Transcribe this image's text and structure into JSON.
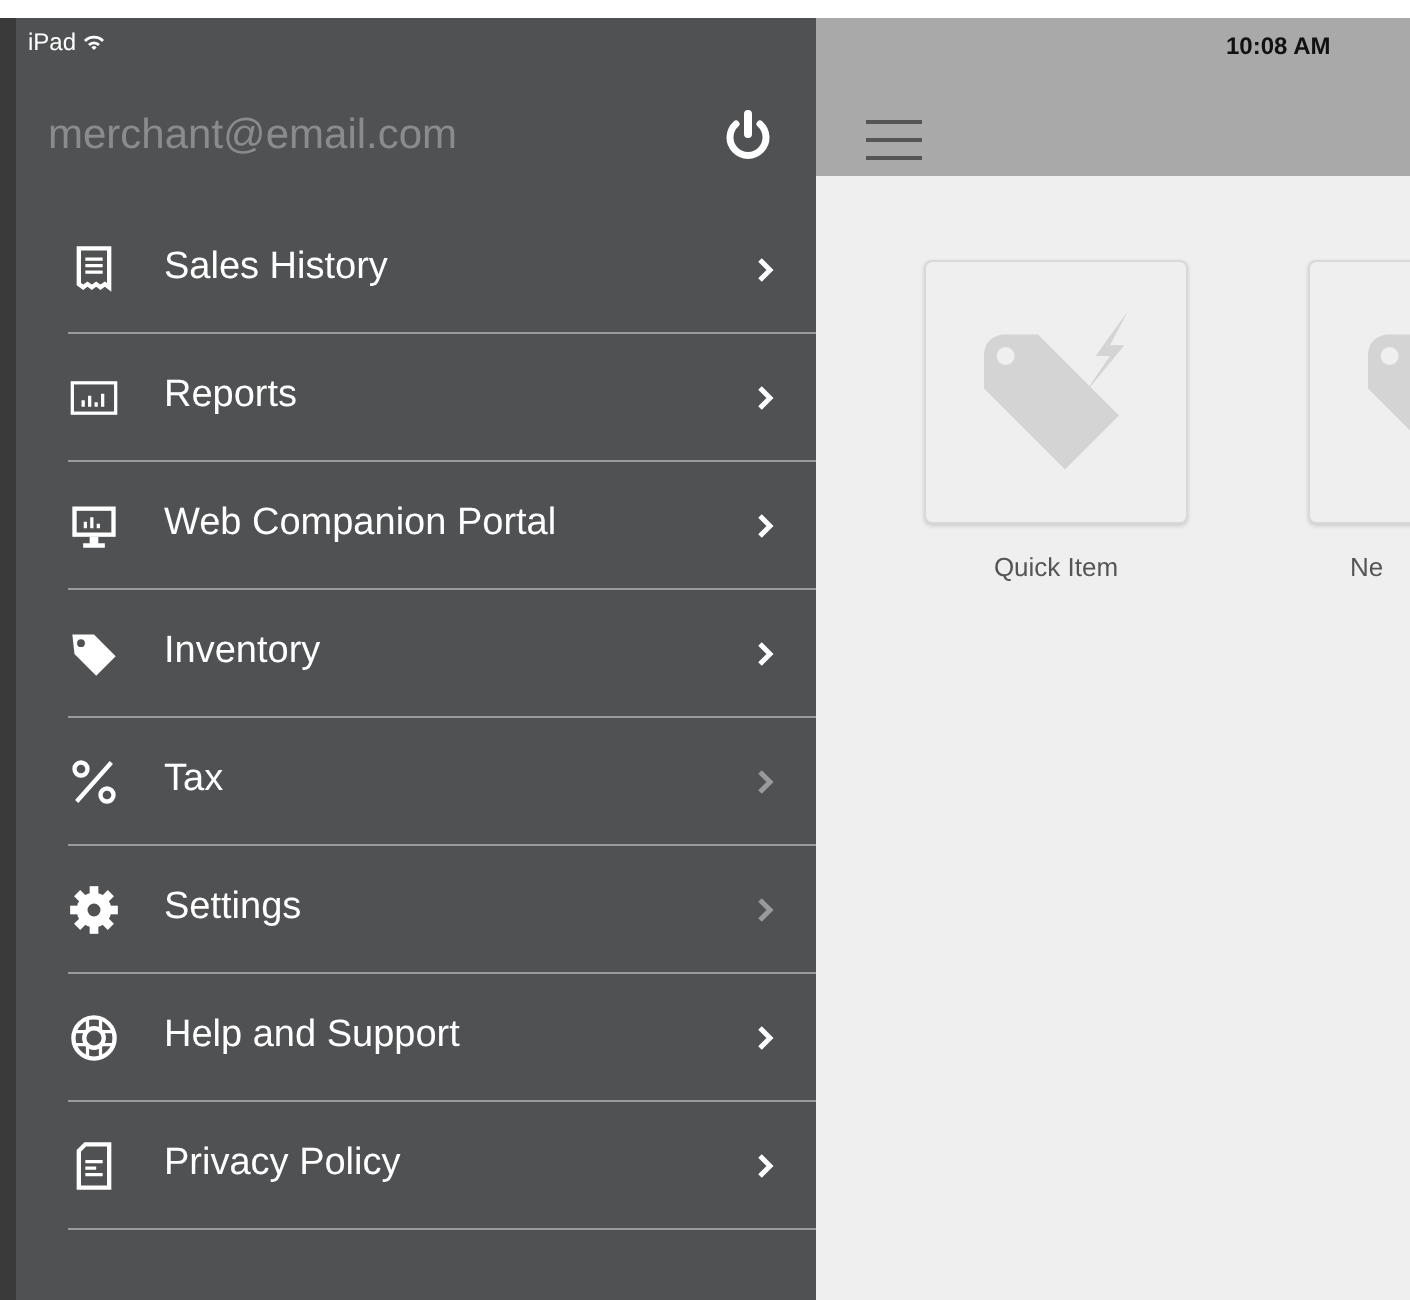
{
  "status_bar": {
    "device": "iPad",
    "time": "10:08 AM"
  },
  "sidebar": {
    "account": "merchant@email.com",
    "items": [
      {
        "label": "Sales History",
        "dimmed": false
      },
      {
        "label": "Reports",
        "dimmed": false
      },
      {
        "label": "Web Companion Portal",
        "dimmed": false
      },
      {
        "label": "Inventory",
        "dimmed": false
      },
      {
        "label": "Tax",
        "dimmed": true
      },
      {
        "label": "Settings",
        "dimmed": true
      },
      {
        "label": "Help and Support",
        "dimmed": false
      },
      {
        "label": "Privacy Policy",
        "dimmed": false
      }
    ]
  },
  "tiles": [
    {
      "label": "Quick Item",
      "kind": "quick"
    },
    {
      "label": "Ne",
      "kind": "plain"
    }
  ]
}
